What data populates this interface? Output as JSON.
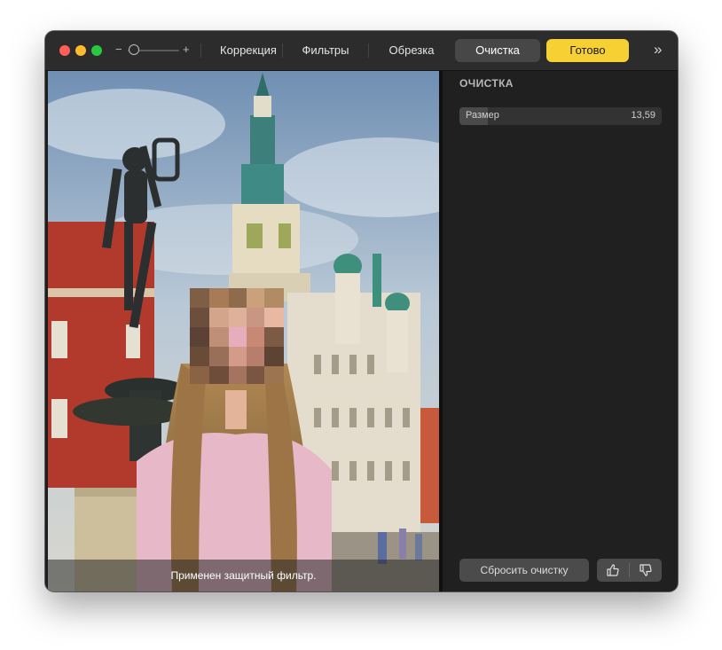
{
  "toolbar": {
    "zoom_minus": "−",
    "zoom_plus": "+",
    "zoom_level": 0.1,
    "tabs": [
      {
        "label": "Коррекция",
        "active": false
      },
      {
        "label": "Фильтры",
        "active": false
      },
      {
        "label": "Обрезка",
        "active": false
      },
      {
        "label": "Очистка",
        "active": true
      }
    ],
    "done_label": "Готово",
    "more_icon": "double-chevron-right-icon"
  },
  "photo": {
    "caption": "Применен защитный фильтр."
  },
  "panel": {
    "title": "ОЧИСТКА",
    "size_label": "Размер",
    "size_value": "13,59",
    "size_fraction": 0.14,
    "reset_label": "Сбросить очистку",
    "thumbs_up_icon": "thumbs-up-icon",
    "thumbs_down_icon": "thumbs-down-icon"
  },
  "colors": {
    "accent": "#f7d133",
    "window_bg": "#1e1e1e",
    "titlebar_bg": "#2c2c2c"
  }
}
